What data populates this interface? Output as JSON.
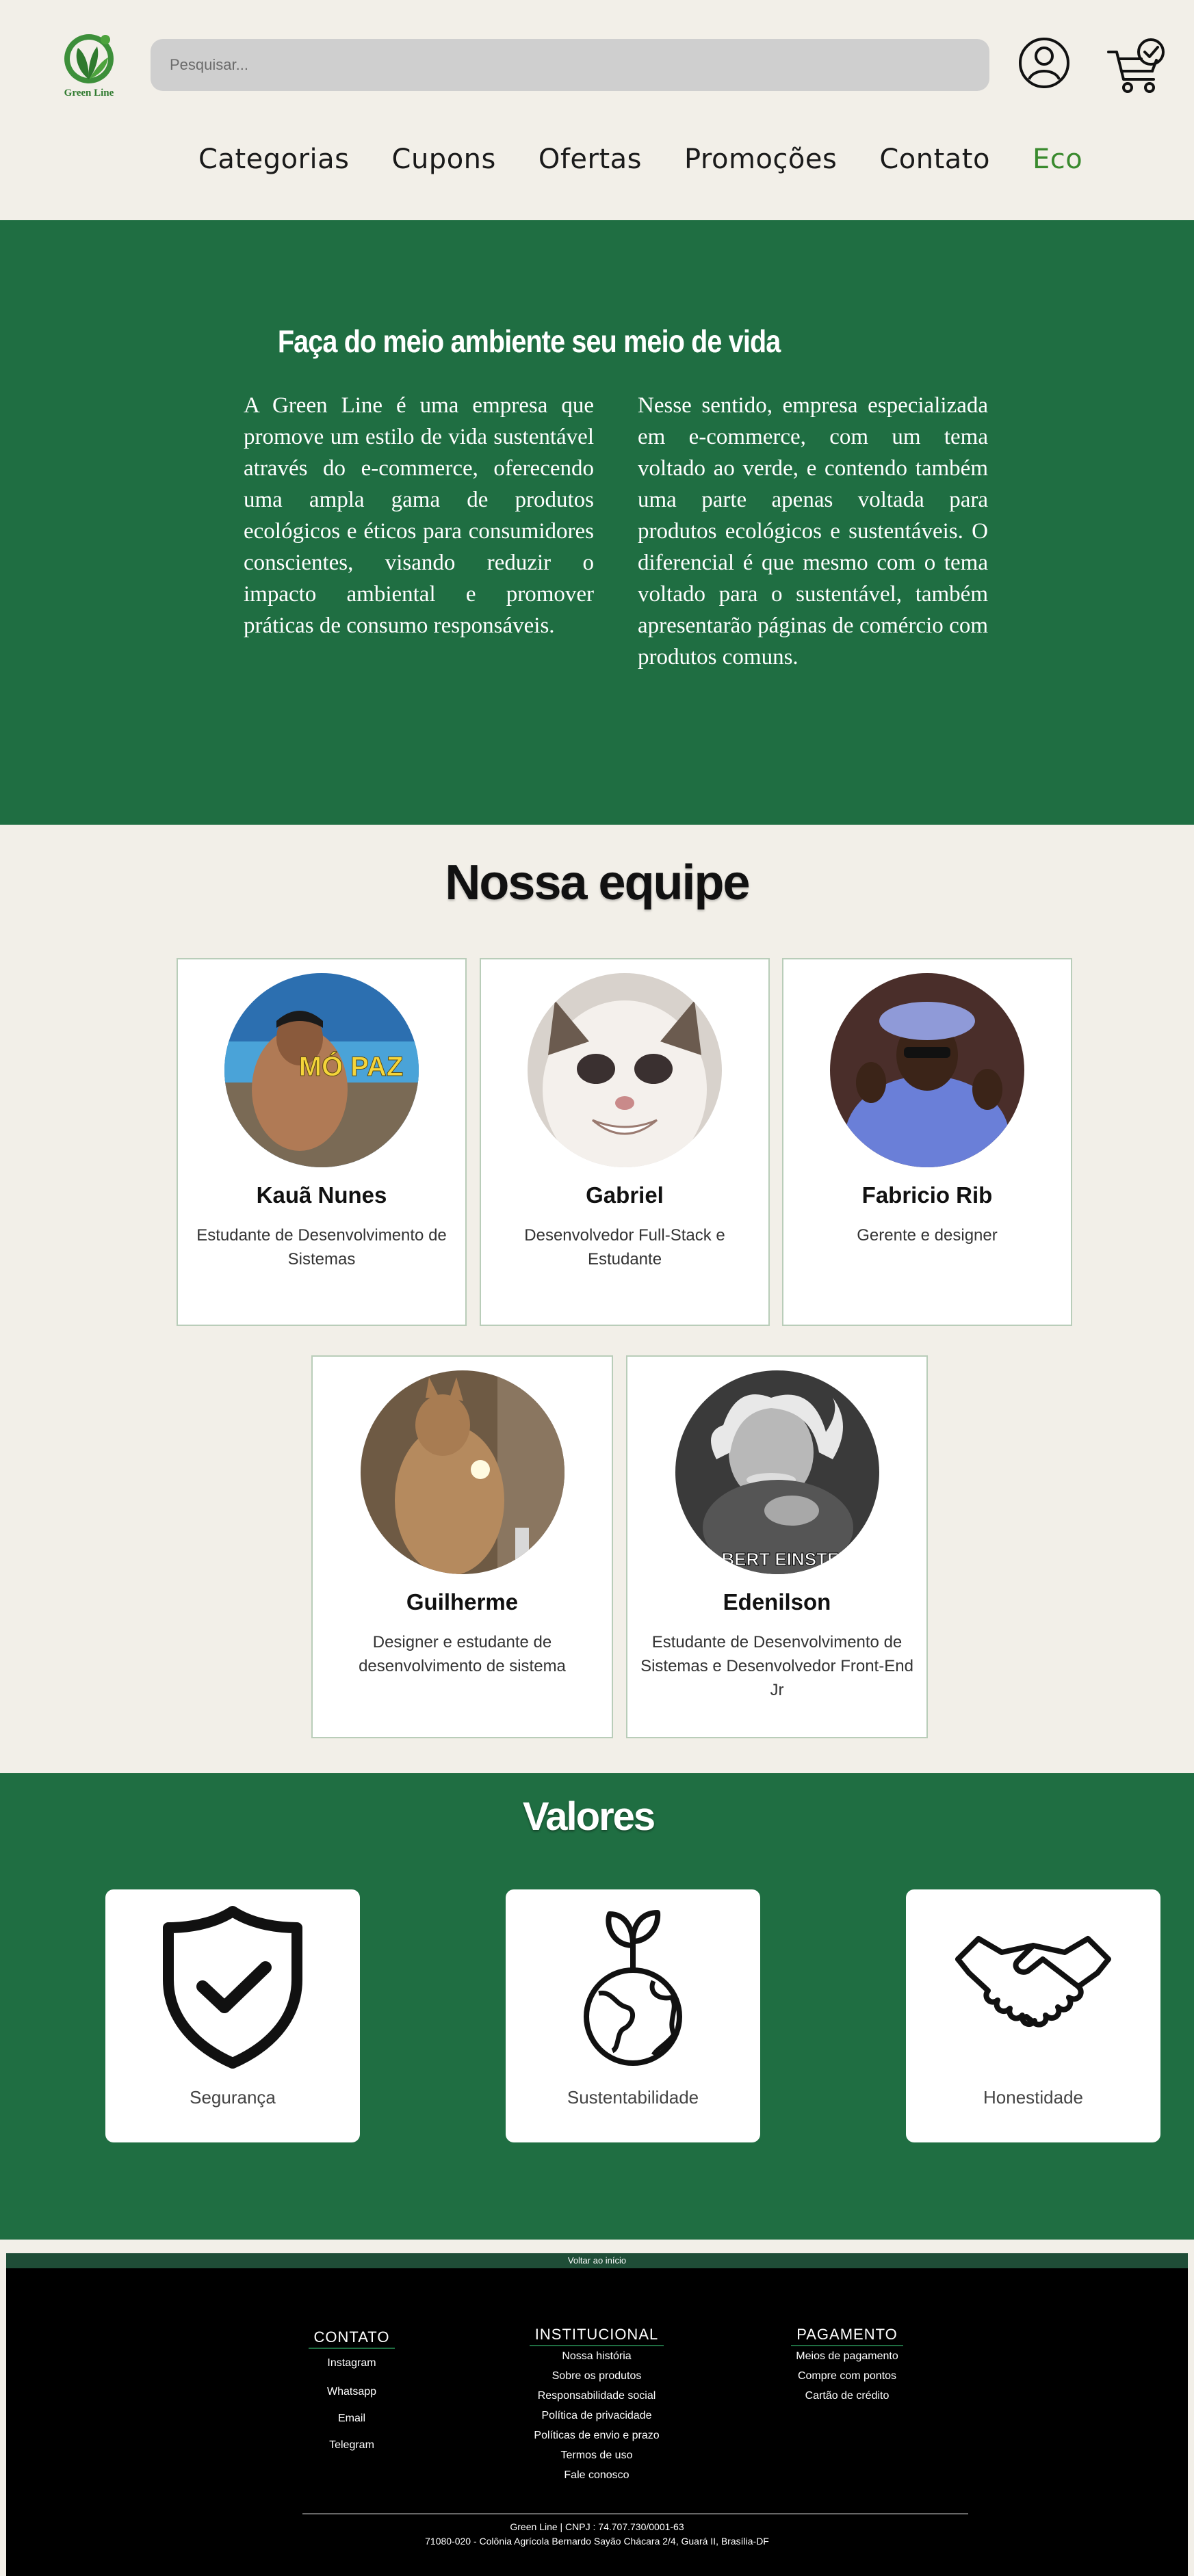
{
  "header": {
    "logo_text": "Green Line",
    "search_placeholder": "Pesquisar...",
    "nav": [
      "Categorias",
      "Cupons",
      "Ofertas",
      "Promoções",
      "Contato",
      "Eco"
    ]
  },
  "hero": {
    "title": "Faça do meio ambiente seu meio de vida",
    "col1": "A Green Line é uma empresa que promove um estilo de vida sustentável através do e-commerce, oferecendo uma ampla gama de produtos ecológicos e éticos para consumidores conscientes, visando reduzir o impacto ambiental e promover práticas de consumo responsáveis.",
    "col2": "Nesse sentido, empresa especializada em e-commerce, com um tema voltado ao verde, e contendo também uma parte apenas voltada para produtos ecológicos e sustentáveis. O diferencial é que mesmo com o tema voltado para o sustentável, também apresentarão páginas de comércio com produtos comuns."
  },
  "team": {
    "title": "Nossa equipe",
    "members": [
      {
        "name": "Kauã Nunes",
        "role": "Estudante de Desenvolvimento de Sistemas",
        "photo_caption": "MÓ PAZ"
      },
      {
        "name": "Gabriel",
        "role": "Desenvolvedor Full-Stack e Estudante"
      },
      {
        "name": "Fabricio Rib",
        "role": "Gerente e designer"
      },
      {
        "name": "Guilherme",
        "role": "Designer e estudante de desenvolvimento de sistema"
      },
      {
        "name": "Edenilson",
        "role": "Estudante de Desenvolvimento de Sistemas e Desenvolvedor Front-End Jr",
        "photo_caption": "ALBERT EINSTEIN"
      }
    ]
  },
  "valores": {
    "title": "Valores",
    "items": [
      {
        "label": "Segurança",
        "icon": "shield-check-icon"
      },
      {
        "label": "Sustentabilidade",
        "icon": "globe-sprout-icon"
      },
      {
        "label": "Honestidade",
        "icon": "handshake-icon"
      }
    ]
  },
  "footer": {
    "back_to_top": "Voltar ao início",
    "contato": {
      "title": "CONTATO",
      "links": [
        "Instagram",
        "Whatsapp",
        "Email",
        "Telegram"
      ]
    },
    "institucional": {
      "title": "INSTITUCIONAL",
      "links": [
        "Nossa história",
        "Sobre os produtos",
        "Responsabilidade social",
        "Política de privacidade",
        "Políticas de envio e prazo",
        "Termos de uso",
        "Fale conosco"
      ]
    },
    "pagamento": {
      "title": "PAGAMENTO",
      "links": [
        "Meios de pagamento",
        "Compre com pontos",
        "Cartão de crédito"
      ]
    },
    "copy_line1": "Green Line | CNPJ : 74.707.730/0001-63",
    "copy_line2": "71080-020 - Colônia Agrícola Bernardo Sayão Chácara 2/4, Guará II, Brasília-DF"
  },
  "colors": {
    "brand_green": "#1f6e42",
    "accent_green": "#3a8a2e",
    "background": "#f2efe8"
  }
}
